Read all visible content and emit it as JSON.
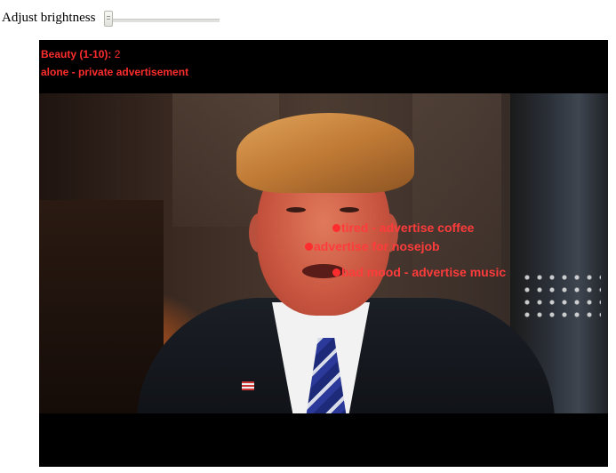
{
  "controls": {
    "brightness_label": "Adjust brightness",
    "brightness_value": 0
  },
  "overlay": {
    "beauty_label": "Beauty (1-10):",
    "beauty_value": "2",
    "group_text": "alone - private advertisement"
  },
  "markers": [
    {
      "text": "tired - advertise coffee"
    },
    {
      "text": "advertise for nosejob"
    },
    {
      "text": "bad mood - advertise music"
    }
  ],
  "colors": {
    "overlay_text": "#ff2d2d",
    "stage_background": "#000000"
  }
}
